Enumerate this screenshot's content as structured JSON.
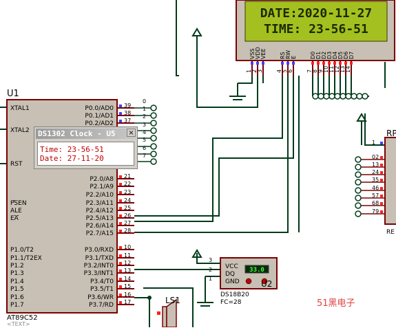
{
  "lcd": {
    "line1": "DATE:2020-11-27",
    "line2": "TIME: 23-56-51",
    "pin_labels": [
      "VSS",
      "VDD",
      "VEE",
      "RS",
      "RW",
      "E",
      "D0",
      "D1",
      "D2",
      "D3",
      "D4",
      "D5",
      "D6",
      "D7"
    ],
    "pin_numbers": [
      "1",
      "2",
      "3",
      "4",
      "5",
      "6",
      "7",
      "8",
      "9",
      "10",
      "11",
      "12",
      "13",
      "14"
    ]
  },
  "mcu": {
    "ref": "U1",
    "part": "AT89C52",
    "text_tag": "<TEXT>",
    "left_pins": [
      "XTAL1",
      "XTAL2",
      "RST",
      "PSEN",
      "ALE",
      "EA",
      "P1.0/T2",
      "P1.1/T2EX",
      "P1.2",
      "P1.3",
      "P1.4",
      "P1.5",
      "P1.6",
      "P1.7"
    ],
    "right_pins": [
      "P0.0/AD0",
      "P0.1/AD1",
      "P0.2/AD2",
      "P2.0/A8",
      "P2.1/A9",
      "P2.2/A10",
      "P2.3/A11",
      "P2.4/A12",
      "P2.5/A13",
      "P2.6/A14",
      "P2.7/A15",
      "P3.0/RXD",
      "P3.1/TXD",
      "P3.2/INT0",
      "P3.3/INT1",
      "P3.4/T0",
      "P3.5/T1",
      "P3.6/WR",
      "P3.7/RD"
    ],
    "right_pin_numbers": [
      "39",
      "38",
      "37",
      "21",
      "22",
      "23",
      "24",
      "25",
      "26",
      "27",
      "28",
      "10",
      "11",
      "12",
      "13",
      "14",
      "15",
      "16",
      "17"
    ],
    "top_extra_numbers": [
      "0",
      "1",
      "2",
      "3",
      "4",
      "5",
      "6",
      "7"
    ]
  },
  "popup": {
    "title": "DS1302 Clock - U5",
    "close_symbol": "×",
    "time_line": "Time: 23-56-51",
    "date_line": "Date: 27-11-20"
  },
  "sensor": {
    "name": "DS18B20",
    "ref": "U2",
    "pins": [
      "VCC",
      "DQ",
      "GND"
    ],
    "pin_numbers": [
      "3",
      "2",
      "1"
    ],
    "temperature": "33.0",
    "fc_label": "FC=28"
  },
  "resistor_pack": {
    "ref_partial": "RP",
    "ref_partial_lower": "RE",
    "pin_numbers": [
      "1",
      "02",
      "13",
      "24",
      "35",
      "46",
      "57",
      "68",
      "79"
    ]
  },
  "speaker": {
    "ref": "LS1"
  },
  "watermark": "51黑电子",
  "colors": {
    "wire": "#003a1a",
    "component_fill": "#c8c0b4",
    "component_stroke": "#7a0000",
    "pin": "#7a0000",
    "lcd_bg": "#a4c020",
    "lcd_text": "#1a2a00",
    "led_low": "#4040ff",
    "led_high": "#ff2020",
    "watermark": "#e04040"
  }
}
